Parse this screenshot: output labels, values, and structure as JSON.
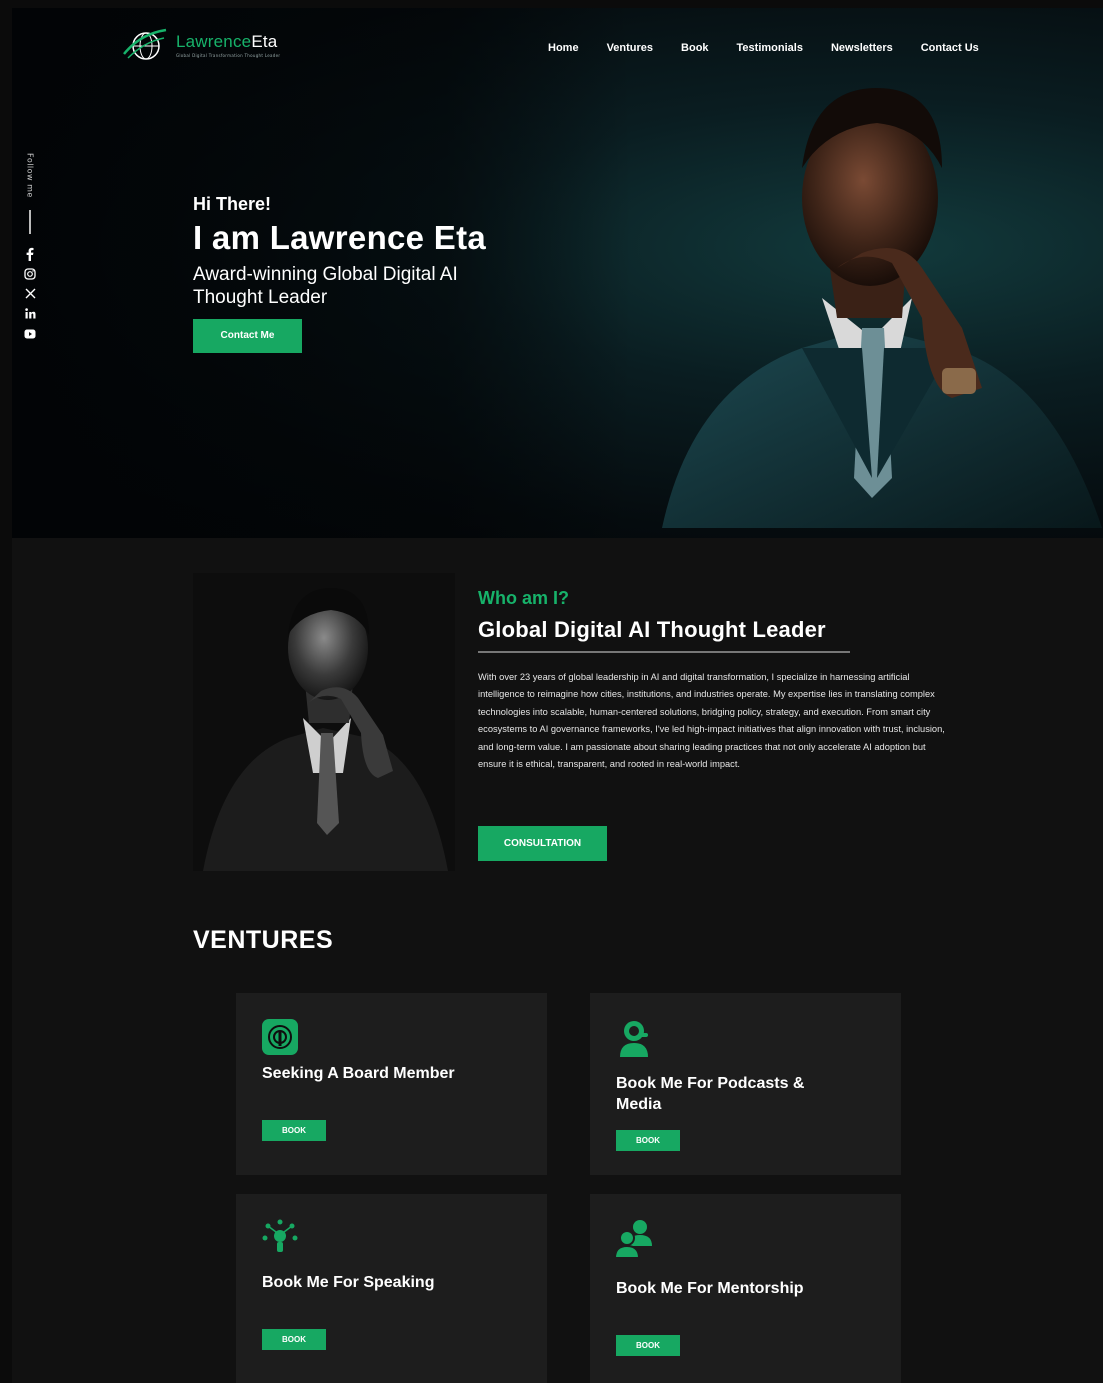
{
  "logo": {
    "name_green": "Lawrence",
    "name_white": "Eta",
    "tagline": "Global Digital Transformation Thought Leader"
  },
  "nav": [
    "Home",
    "Ventures",
    "Book",
    "Testimonials",
    "Newsletters",
    "Contact Us"
  ],
  "sidebar": {
    "follow_label": "Follow me",
    "socials": [
      "facebook-icon",
      "instagram-icon",
      "x-icon",
      "linkedin-icon",
      "youtube-icon"
    ]
  },
  "hero": {
    "greeting": "Hi There!",
    "name": "I am Lawrence Eta",
    "subtitle": "Award-winning Global Digital AI Thought Leader",
    "button": "Contact Me"
  },
  "about": {
    "eyebrow": "Who am I?",
    "title": "Global Digital AI Thought Leader",
    "body": "With over 23 years of global leadership in AI and digital transformation, I specialize in harnessing artificial intelligence to reimagine how cities, institutions, and industries operate. My expertise lies in translating complex technologies into scalable, human-centered solutions, bridging policy, strategy, and execution. From smart city ecosystems to AI governance frameworks, I've led high-impact initiatives that align innovation with trust, inclusion, and long-term value. I am passionate about sharing leading practices that not only accelerate AI adoption but ensure it is ethical, transparent, and rooted in real-world impact.",
    "button": "CONSULTATION"
  },
  "ventures": {
    "title": "VENTURES",
    "cards": [
      {
        "title": "Seeking A Board Member",
        "button": "BOOK",
        "icon": "board-icon"
      },
      {
        "title": "Book Me For Podcasts & Media",
        "button": "BOOK",
        "icon": "podcast-icon"
      },
      {
        "title": "Book Me For Speaking",
        "button": "BOOK",
        "icon": "speaking-icon"
      },
      {
        "title": "Book Me For Mentorship",
        "button": "BOOK",
        "icon": "mentorship-icon"
      }
    ]
  },
  "colors": {
    "accent": "#17a862",
    "background": "#111111",
    "card": "#1d1d1d"
  }
}
